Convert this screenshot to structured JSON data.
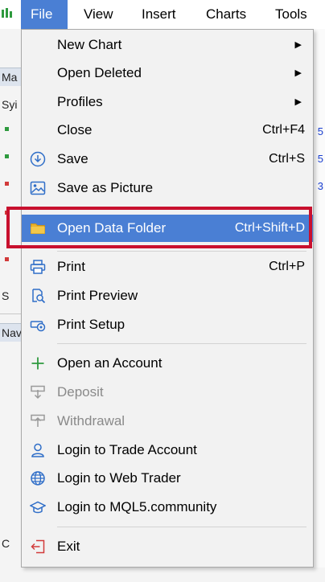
{
  "menubar": {
    "items": [
      "File",
      "View",
      "Insert",
      "Charts",
      "Tools"
    ],
    "active_index": 0
  },
  "background": {
    "fragments": [
      "Ma",
      "Syi",
      "S",
      "Nav",
      "C"
    ]
  },
  "file_menu": {
    "items": [
      {
        "label": "New Chart",
        "icon": "none",
        "submenu": true
      },
      {
        "label": "Open Deleted",
        "icon": "none",
        "submenu": true
      },
      {
        "label": "Profiles",
        "icon": "none",
        "submenu": true
      },
      {
        "label": "Close",
        "icon": "none",
        "shortcut": "Ctrl+F4"
      },
      {
        "label": "Save",
        "icon": "save-icon",
        "shortcut": "Ctrl+S"
      },
      {
        "label": "Save as Picture",
        "icon": "picture-icon"
      },
      {
        "label": "Open Data Folder",
        "icon": "folder-icon",
        "shortcut": "Ctrl+Shift+D",
        "highlighted": true
      },
      {
        "label": "Print",
        "icon": "printer-icon",
        "shortcut": "Ctrl+P"
      },
      {
        "label": "Print Preview",
        "icon": "print-preview-icon"
      },
      {
        "label": "Print Setup",
        "icon": "print-setup-icon"
      },
      {
        "label": "Open an Account",
        "icon": "plus-icon"
      },
      {
        "label": "Deposit",
        "icon": "deposit-icon",
        "disabled": true
      },
      {
        "label": "Withdrawal",
        "icon": "withdrawal-icon",
        "disabled": true
      },
      {
        "label": "Login to Trade Account",
        "icon": "user-icon"
      },
      {
        "label": "Login to Web Trader",
        "icon": "globe-icon"
      },
      {
        "label": "Login to MQL5.community",
        "icon": "graduation-cap-icon"
      },
      {
        "label": "Exit",
        "icon": "exit-icon"
      }
    ]
  },
  "colors": {
    "highlight": "#4a7fd4",
    "callout_border": "#c8102e",
    "icon_blue": "#2f6ec8",
    "folder_yellow": "#e8b22e",
    "plus_green": "#2e9a3e",
    "exit_red": "#d23a3a"
  }
}
